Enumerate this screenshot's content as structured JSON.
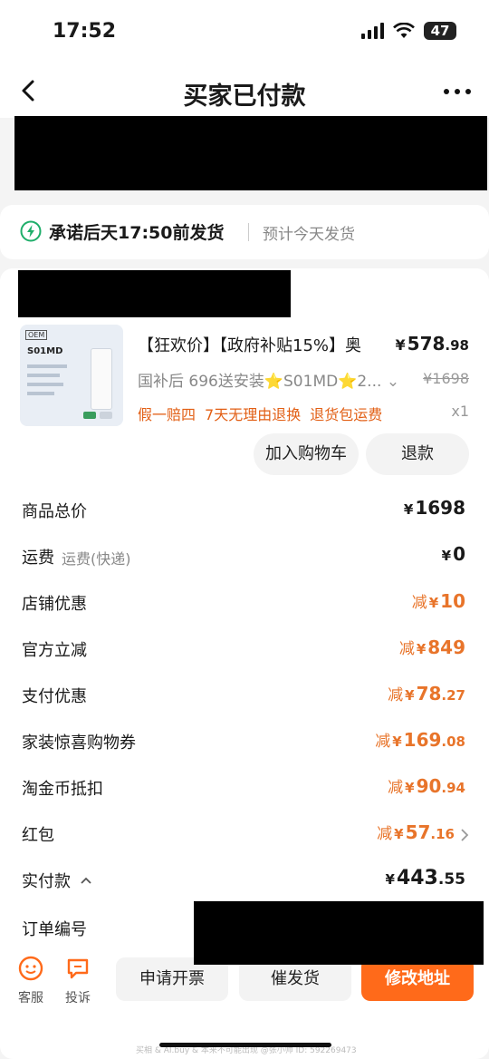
{
  "status": {
    "time": "17:52",
    "battery": "47"
  },
  "nav": {
    "title": "买家已付款"
  },
  "shipping": {
    "main": "承诺后天17:50前发货",
    "sub": "预计今天发货"
  },
  "product": {
    "title": "【狂欢价】【政府补贴15%】奥",
    "price_int": "578",
    "price_dec": ".98",
    "currency": "¥",
    "sku": "国补后 696送安装⭐S01MD⭐2...",
    "original_price": "¥1698",
    "tags": [
      "假一赔四",
      "7天无理由退换",
      "退货包运费"
    ],
    "qty": "x1",
    "thumb_model": "S01MD"
  },
  "buttons": {
    "add_cart": "加入购物车",
    "refund": "退款"
  },
  "summary": [
    {
      "label": "商品总价",
      "sub": "",
      "prefix": "",
      "yen": "¥",
      "int": "1698",
      "dec": "",
      "orange": false
    },
    {
      "label": "运费",
      "sub": "运费(快递)",
      "prefix": "",
      "yen": "¥",
      "int": "0",
      "dec": "",
      "orange": false
    },
    {
      "label": "店铺优惠",
      "sub": "",
      "prefix": "减",
      "yen": "¥",
      "int": "10",
      "dec": "",
      "orange": true
    },
    {
      "label": "官方立减",
      "sub": "",
      "prefix": "减",
      "yen": "¥",
      "int": "849",
      "dec": "",
      "orange": true
    },
    {
      "label": "支付优惠",
      "sub": "",
      "prefix": "减",
      "yen": "¥",
      "int": "78",
      "dec": ".27",
      "orange": true
    },
    {
      "label": "家装惊喜购物券",
      "sub": "",
      "prefix": "减",
      "yen": "¥",
      "int": "169",
      "dec": ".08",
      "orange": true
    },
    {
      "label": "淘金币抵扣",
      "sub": "",
      "prefix": "减",
      "yen": "¥",
      "int": "90",
      "dec": ".94",
      "orange": true
    },
    {
      "label": "红包",
      "sub": "",
      "prefix": "减",
      "yen": "¥",
      "int": "57",
      "dec": ".16",
      "orange": true
    },
    {
      "label": "实付款",
      "sub": "",
      "prefix": "",
      "yen": "¥",
      "int": "443",
      "dec": ".55",
      "orange": false
    }
  ],
  "order_no_label": "订单编号",
  "bottom": {
    "service": "客服",
    "complain": "投诉",
    "invoice": "申请开票",
    "urge": "催发货",
    "modify_address": "修改地址"
  },
  "watermark": "买相 & AI.buy & 本来不可能出现 @张小帅 ID: 592269473",
  "colors": {
    "accent": "#ff6a1a",
    "discount": "#e8742a",
    "ship_green": "#1fae6a"
  }
}
